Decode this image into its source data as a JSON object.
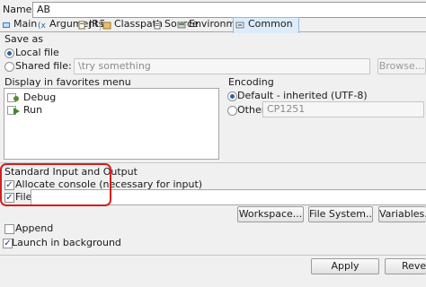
{
  "name_label": "Name:",
  "name_value": "AB",
  "tabs": [
    {
      "label": "Main",
      "icon": "main-tab-icon"
    },
    {
      "label": "Arguments",
      "icon": "arguments-tab-icon"
    },
    {
      "label": "JRE",
      "icon": "jre-tab-icon"
    },
    {
      "label": "Classpath",
      "icon": "classpath-tab-icon"
    },
    {
      "label": "Source",
      "icon": "source-tab-icon"
    },
    {
      "label": "Environment",
      "icon": "environment-tab-icon"
    },
    {
      "label": "Common",
      "icon": "common-tab-icon",
      "active": true
    }
  ],
  "save_as": {
    "label": "Save as",
    "local_file": "Local file",
    "shared_file": "Shared file:",
    "shared_file_value": "\\try something",
    "browse": "Browse..."
  },
  "favorites": {
    "label": "Display in favorites menu",
    "items": [
      "Debug",
      "Run"
    ]
  },
  "encoding": {
    "label": "Encoding",
    "default": "Default - inherited (UTF-8)",
    "other": "Other",
    "other_value": "CP1251"
  },
  "stdio": {
    "label": "Standard Input and Output",
    "allocate_console": "Allocate console (necessary for input)",
    "file": "File:",
    "workspace": "Workspace...",
    "file_system": "File System...",
    "variables": "Variables...",
    "append": "Append"
  },
  "launch_background": "Launch in background",
  "footer": {
    "apply": "Apply",
    "revert": "Revert"
  },
  "colors": {
    "annotation": "#d21f1f",
    "active_tab": "#dcecfb"
  }
}
